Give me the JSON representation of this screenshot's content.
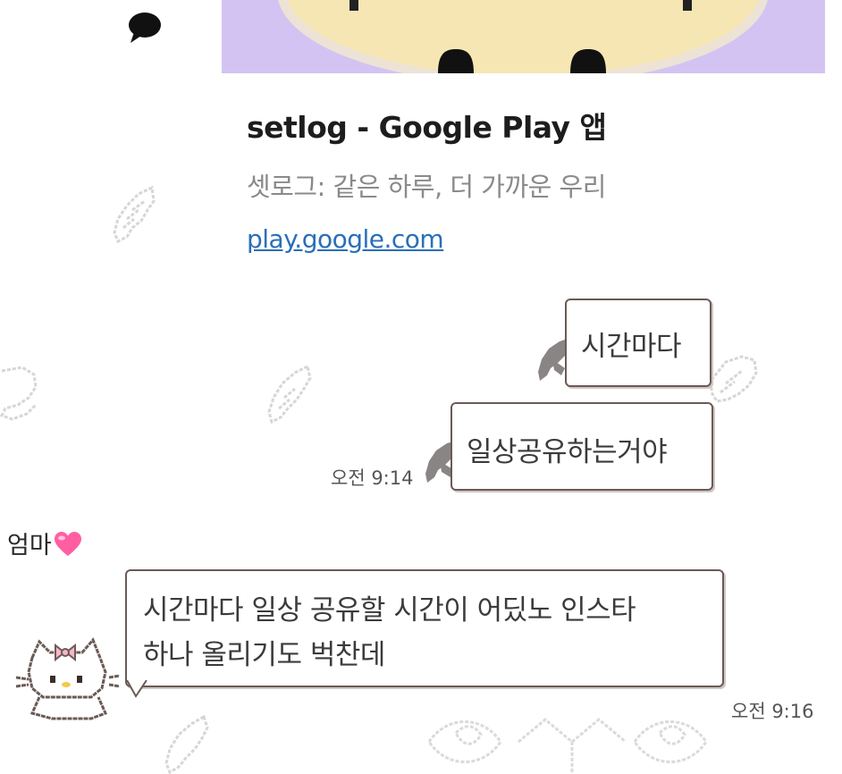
{
  "link_preview": {
    "title": "setlog - Google Play 앱",
    "description": "셋로그: 같은 하루, 더 가까운 우리",
    "url": "play.google.com"
  },
  "messages": {
    "sent_1": {
      "text": "시간마다"
    },
    "sent_2": {
      "text": "일상공유하는거야",
      "time": "오전 9:14"
    },
    "received_1": {
      "sender": "엄마",
      "line1": "시간마다 일상 공유할 시간이 어딨노 인스타",
      "line2": "하나 올리기도 벅찬데",
      "time": "오전 9:16"
    }
  },
  "colors": {
    "preview_bg": "#d3c3f2",
    "bubble_border": "#6b5a55",
    "link": "#2a6fb8",
    "heart": "#ff5fa2"
  },
  "icons": [
    "chat-bubble-icon",
    "heart-emoji",
    "hello-kitty-avatar",
    "angel-wing-decoration"
  ]
}
